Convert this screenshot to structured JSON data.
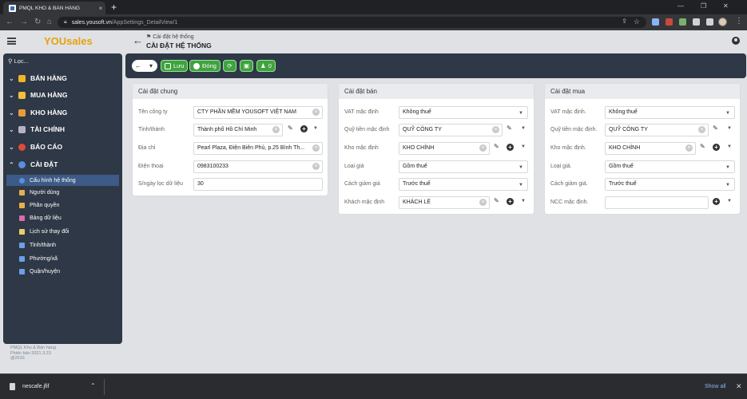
{
  "browser": {
    "tab_title": "PMQL KHO & BÁN HÀNG",
    "tab_close": "×",
    "new_tab": "+",
    "url_host": "sales.yousoft.vn",
    "url_path": "/AppSettings_DetailView/1"
  },
  "app": {
    "brand": "YOUsales",
    "breadcrumb": "Cài đặt hệ thống",
    "page_title": "CÀI ĐẶT HỆ THỐNG"
  },
  "sidebar": {
    "search_placeholder": "Lọc...",
    "groups": [
      {
        "label": "BÁN HÀNG",
        "icon": "cart-icon"
      },
      {
        "label": "MUA HÀNG",
        "icon": "shopping-bag-icon"
      },
      {
        "label": "KHO HÀNG",
        "icon": "warehouse-icon"
      },
      {
        "label": "TÀI CHÍNH",
        "icon": "finance-icon"
      },
      {
        "label": "BÁO CÁO",
        "icon": "report-icon"
      },
      {
        "label": "CÀI ĐẶT",
        "icon": "settings-icon"
      }
    ],
    "settings_items": [
      {
        "label": "Cấu hình hệ thống",
        "active": true
      },
      {
        "label": "Người dùng"
      },
      {
        "label": "Phân quyền"
      },
      {
        "label": "Bảng dữ liệu"
      },
      {
        "label": "Lịch sử thay đổi"
      },
      {
        "label": "Tỉnh/thành"
      },
      {
        "label": "Phường/xã"
      },
      {
        "label": "Quận/huyện"
      }
    ],
    "footer": [
      "PMQL Kho & Bán hàng",
      "Phiên bản 2021.3.23",
      "@2016"
    ]
  },
  "toolbar": {
    "save": "Lưu",
    "close": "Đóng",
    "notify_count": "0"
  },
  "panels": {
    "general": {
      "title": "Cài đặt chung",
      "company_label": "Tên công ty",
      "company_value": "CTY PHẦN MỀM YOUSOFT VIỆT NAM",
      "province_label": "Tỉnh/thành",
      "province_value": "Thành phố Hồ Chí Minh",
      "address_label": "Địa chỉ",
      "address_value": "Pearl Plaza, Điện Biên Phủ, p.25 Bình Th...",
      "phone_label": "Điện thoại",
      "phone_value": "0983100233",
      "days_label": "S/ngày lọc dữ liệu",
      "days_value": "30"
    },
    "sales": {
      "title": "Cài đặt bán",
      "vat_label": "VAT mặc định",
      "vat_value": "Không thuế",
      "fund_label": "Quỹ tiền mặc định",
      "fund_value": "QUỸ CÔNG TY",
      "warehouse_label": "Kho mặc định",
      "warehouse_value": "KHO CHÍNH",
      "price_label": "Loại giá",
      "price_value": "Gồm thuế",
      "discount_label": "Cách giảm giá",
      "discount_value": "Trước thuế",
      "customer_label": "Khách mặc định",
      "customer_value": "KHÁCH LẺ"
    },
    "purchase": {
      "title": "Cài đặt mua",
      "vat_label": "VAT mặc định.",
      "vat_value": "Không thuế",
      "fund_label": "Quỹ tiền mặc định.",
      "fund_value": "QUỸ CÔNG TY",
      "warehouse_label": "Kho mặc định.",
      "warehouse_value": "KHO CHÍNH",
      "price_label": "Loại giá.",
      "price_value": "Gồm thuế",
      "discount_label": "Cách giảm giá.",
      "discount_value": "Trước thuế",
      "supplier_label": "NCC mặc định.",
      "supplier_value": ""
    }
  },
  "downloads": {
    "file": "nescafe.jfif",
    "show_all": "Show all"
  },
  "colors": {
    "brand": "#e7a20b",
    "sidebar_bg": "#2e3846",
    "active_item": "#3d5b86",
    "button_green": "#3fa33f"
  }
}
